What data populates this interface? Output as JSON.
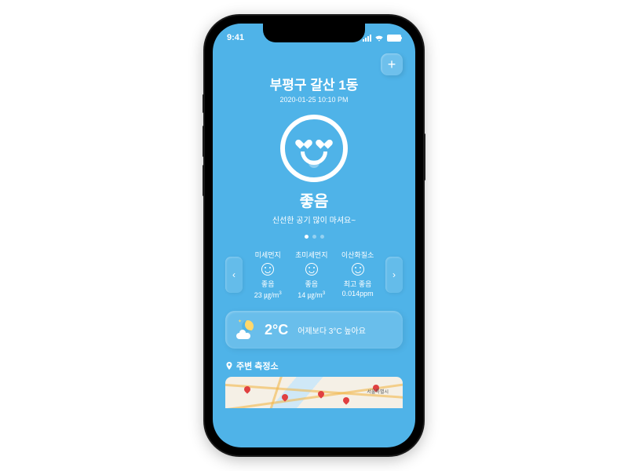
{
  "status": {
    "time": "9:41"
  },
  "add_button_glyph": "+",
  "location": {
    "name": "부평구 갈산 1동",
    "timestamp": "2020-01-25 10:10 PM"
  },
  "air_quality": {
    "status": "좋음",
    "description": "신선한 공기 많이 마셔요~"
  },
  "metrics": [
    {
      "name": "미세먼지",
      "status": "좋음",
      "value": "23 ㎍/m",
      "unit_sup": "3"
    },
    {
      "name": "초미세먼지",
      "status": "좋음",
      "value": "14 ㎍/m",
      "unit_sup": "3"
    },
    {
      "name": "이산화질소",
      "status": "최고 좋음",
      "value": "0.014ppm",
      "unit_sup": ""
    }
  ],
  "nav": {
    "left": "‹",
    "right": "›"
  },
  "weather": {
    "temperature": "2°C",
    "comparison": "어제보다 3°C 높아요"
  },
  "map": {
    "title": "주변 측정소",
    "labels": {
      "seoul": "서울특별시"
    }
  }
}
